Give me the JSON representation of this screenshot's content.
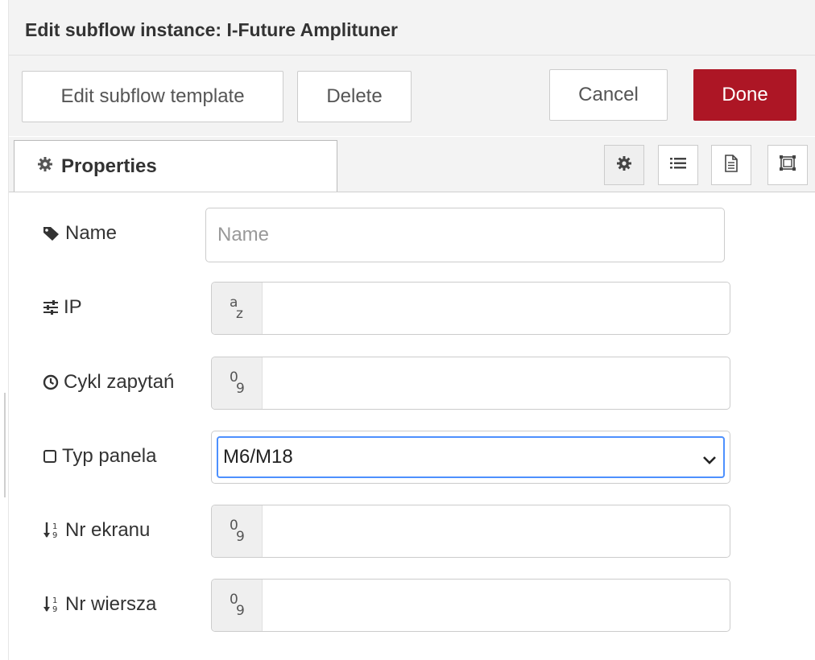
{
  "tray": {
    "title": "Edit subflow instance: I-Future Amplituner"
  },
  "toolbar": {
    "edit_template_label": "Edit subflow template",
    "delete_label": "Delete",
    "cancel_label": "Cancel",
    "done_label": "Done"
  },
  "tabs": {
    "properties_label": "Properties",
    "icon_buttons": [
      "gear-icon",
      "list-icon",
      "document-icon",
      "frame-icon"
    ]
  },
  "form": {
    "name": {
      "label": "Name",
      "icon": "tag-icon",
      "placeholder": "Name",
      "value": ""
    },
    "ip": {
      "label": "IP",
      "icon": "sliders-icon",
      "type": "string",
      "type_glyph_top": "a",
      "type_glyph_bottom": "z",
      "value": ""
    },
    "cycle": {
      "label": "Cykl zapytań",
      "icon": "clock-icon",
      "type": "number",
      "type_glyph_top": "0",
      "type_glyph_bottom": "9",
      "value": ""
    },
    "panel_type": {
      "label": "Typ panela",
      "icon": "square-icon",
      "selected": "M6/M18"
    },
    "screen_no": {
      "label": "Nr ekranu",
      "icon": "sort-numeric-icon",
      "type": "number",
      "type_glyph_top": "0",
      "type_glyph_bottom": "9",
      "value": ""
    },
    "row_no": {
      "label": "Nr wiersza",
      "icon": "sort-numeric-icon",
      "type": "number",
      "type_glyph_top": "0",
      "type_glyph_bottom": "9",
      "value": ""
    }
  },
  "colors": {
    "done_button": "#ad1625",
    "focus_ring": "#4d90fe",
    "header_bg": "#f3f3f3"
  }
}
